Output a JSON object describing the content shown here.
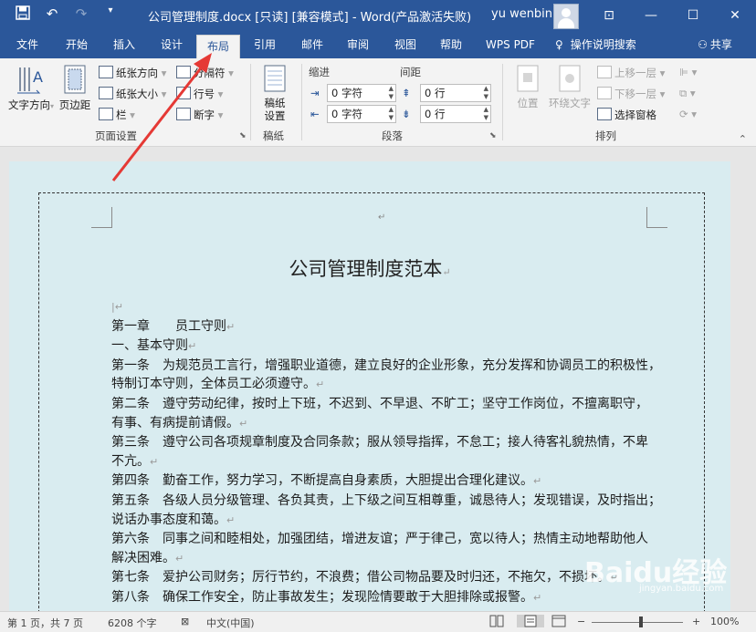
{
  "titlebar": {
    "title": "公司管理制度.docx [只读] [兼容模式]  -  Word(产品激活失败)",
    "user": "yu wenbin",
    "qat_icons": [
      "save-icon",
      "undo-icon",
      "redo-icon",
      "customize-icon"
    ]
  },
  "tabs": [
    "文件",
    "开始",
    "插入",
    "设计",
    "布局",
    "引用",
    "邮件",
    "审阅",
    "视图",
    "帮助",
    "WPS PDF",
    "操作说明搜索",
    "共享"
  ],
  "active_tab": "布局",
  "ribbon": {
    "page_setup": {
      "text_direction": "文字方向",
      "margins": "页边距",
      "orientation": "纸张方向",
      "size": "纸张大小",
      "columns": "栏",
      "breaks": "分隔符",
      "line_numbers": "行号",
      "hyphenation": "断字",
      "label": "页面设置"
    },
    "manuscript": {
      "button": "稿纸设置",
      "btn_line1": "稿纸",
      "btn_line2": "设置",
      "label": "稿纸"
    },
    "paragraph": {
      "indent_label": "缩进",
      "spacing_label": "间距",
      "indent_left": "0 字符",
      "indent_right": "0 字符",
      "spacing_before": "0 行",
      "spacing_after": "0 行",
      "label": "段落"
    },
    "arrange": {
      "position": "位置",
      "wrap_text": "环绕文字",
      "bring_forward": "上移一层",
      "send_backward": "下移一层",
      "selection_pane": "选择窗格",
      "label": "排列"
    }
  },
  "document": {
    "title": "公司管理制度范本",
    "paragraphs": [
      "第一章　　员工守则",
      "一、基本守则",
      "第一条　为规范员工言行，增强职业道德，建立良好的企业形象，充分发挥和协调员工的积极性，",
      "特制订本守则，全体员工必须遵守。",
      "第二条　遵守劳动纪律，按时上下班，不迟到、不早退、不旷工；坚守工作岗位，不擅离职守，",
      "有事、有病提前请假。",
      "第三条　遵守公司各项规章制度及合同条款；服从领导指挥，不怠工；接人待客礼貌热情，不卑",
      "不亢。",
      "第四条　勤奋工作，努力学习，不断提高自身素质，大胆提出合理化建议。",
      "第五条　各级人员分级管理、各负其责，上下级之间互相尊重，诚恳待人；发现错误，及时指出；",
      "说话办事态度和蔼。",
      "第六条　同事之间和睦相处，加强团结，增进友谊；严于律己，宽以待人；热情主动地帮助他人",
      "解决困难。",
      "第七条　爱护公司财务；厉行节约，不浪费；借公司物品要及时归还，不拖欠，不损坏。",
      "第八条　确保工作安全，防止事故发生；发现险情要敢于大胆排除或报警。"
    ]
  },
  "watermark": {
    "brand": "Baidu经验",
    "url": "jingyan.baidu.com"
  },
  "status": {
    "page": "第 1 页，共 7 页",
    "words": "6208 个字",
    "language": "中文(中国)",
    "zoom": "100%",
    "zoom_level": 1.0
  },
  "colors": {
    "accent": "#2b579a",
    "annotation": "#e53935",
    "page_bg": "#d9ecf0"
  }
}
